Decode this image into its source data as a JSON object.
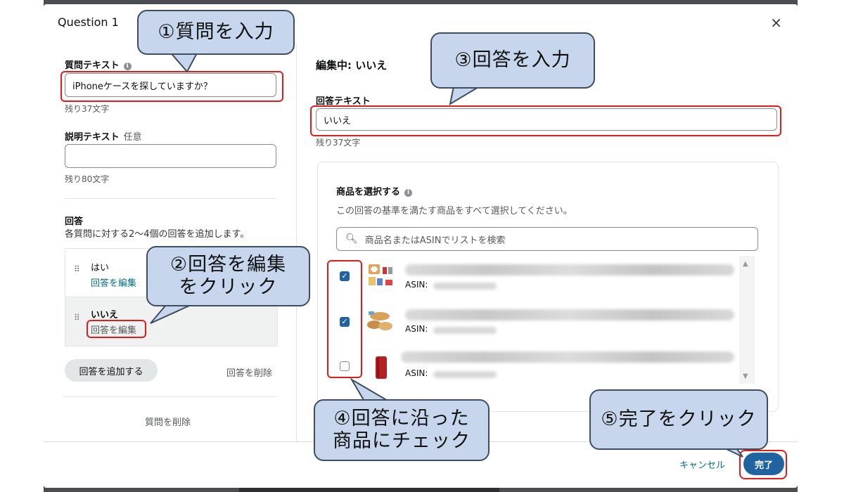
{
  "modal": {
    "title": "Question 1",
    "close": "×"
  },
  "left": {
    "question_label": "質問テキスト",
    "question_value": "iPhoneケースを探していますか？",
    "question_remaining": "残り37文字",
    "desc_label": "説明テキスト",
    "desc_optional": "任意",
    "desc_value": "",
    "desc_remaining": "残り80文字",
    "answers_title": "回答",
    "answers_hint": "各質問に対する2～4個の回答を追加します。",
    "answers": [
      {
        "name": "はい",
        "edit": "回答を編集"
      },
      {
        "name": "いいえ",
        "edit": "回答を編集"
      }
    ],
    "add_answer": "回答を追加する",
    "delete_answer": "回答を削除",
    "delete_question": "質問を削除"
  },
  "right": {
    "editing": "編集中: いいえ",
    "answer_label": "回答テキスト",
    "answer_value": "いいえ",
    "answer_remaining": "残り37文字",
    "products_title": "商品を選択する",
    "products_hint": "この回答の基準を満たす商品をすべて選択してください。",
    "search_placeholder": "商品名またはASINでリストを検索",
    "products": [
      {
        "checked": true,
        "asin_label": "ASIN:"
      },
      {
        "checked": true,
        "asin_label": "ASIN:"
      },
      {
        "checked": false,
        "asin_label": "ASIN:"
      }
    ]
  },
  "footer": {
    "cancel": "キャンセル",
    "done": "完了"
  },
  "callouts": {
    "c1": "①質問を入力",
    "c2_line1": "②回答を編集",
    "c2_line2": "をクリック",
    "c3": "③回答を入力",
    "c4_line1": "④回答に沿った",
    "c4_line2": "商品にチェック",
    "c5": "⑤完了をクリック"
  },
  "colors": {
    "accent": "#2162a1",
    "link": "#007185",
    "highlight": "#e31b1b",
    "callout_fill": "#c7d6ec"
  }
}
